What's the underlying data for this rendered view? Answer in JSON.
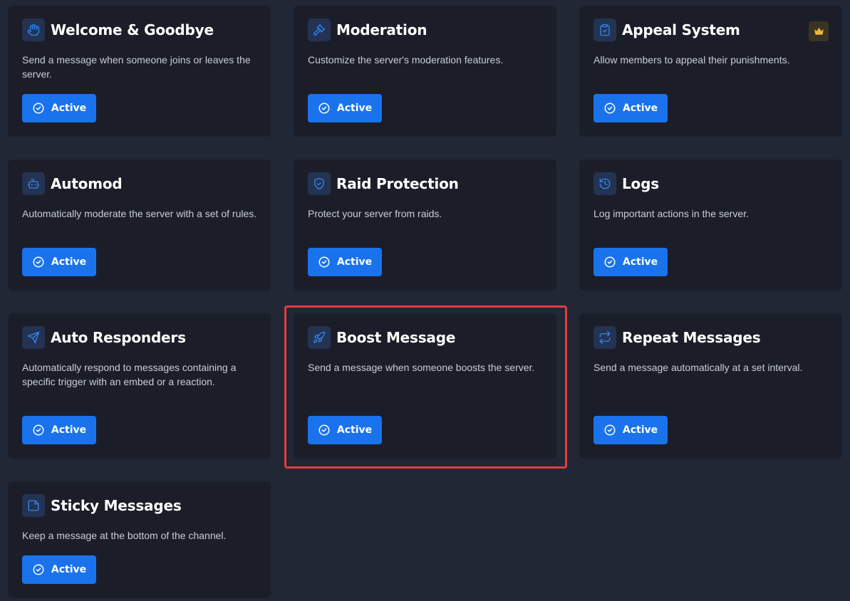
{
  "colors": {
    "background": "#222736",
    "card": "#1b1e29",
    "accent": "#1a73ec",
    "highlight": "#e23c3c",
    "premium": "#f0b93a"
  },
  "modules": [
    {
      "title": "Welcome & Goodbye",
      "icon": "hand-icon",
      "description": "Send a message when someone joins or leaves the server.",
      "button": "Active"
    },
    {
      "title": "Moderation",
      "icon": "gavel-icon",
      "description": "Customize the server's moderation features.",
      "button": "Active"
    },
    {
      "title": "Appeal System",
      "icon": "clipboard-check-icon",
      "description": "Allow members to appeal their punishments.",
      "button": "Active",
      "badge_icon": "crown-icon"
    },
    {
      "title": "Automod",
      "icon": "robot-icon",
      "description": "Automatically moderate the server with a set of rules.",
      "button": "Active"
    },
    {
      "title": "Raid Protection",
      "icon": "shield-check-icon",
      "description": "Protect your server from raids.",
      "button": "Active"
    },
    {
      "title": "Logs",
      "icon": "history-icon",
      "description": "Log important actions in the server.",
      "button": "Active"
    },
    {
      "title": "Auto Responders",
      "icon": "send-icon",
      "description": "Automatically respond to messages containing a specific trigger with an embed or a reaction.",
      "button": "Active"
    },
    {
      "title": "Boost Message",
      "icon": "rocket-icon",
      "description": "Send a message when someone boosts the server.",
      "button": "Active"
    },
    {
      "title": "Repeat Messages",
      "icon": "repeat-icon",
      "description": "Send a message automatically at a set interval.",
      "button": "Active"
    },
    {
      "title": "Sticky Messages",
      "icon": "sticky-note-icon",
      "description": "Keep a message at the bottom of the channel.",
      "button": "Active"
    }
  ]
}
